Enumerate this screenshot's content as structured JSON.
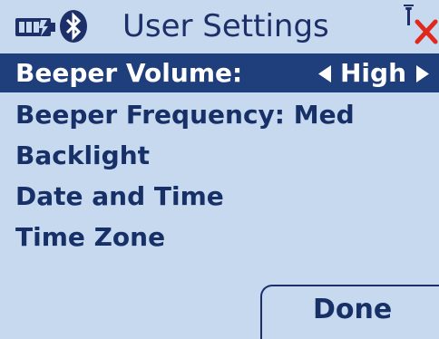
{
  "status": {
    "battery_icon": "battery-icon",
    "bluetooth_icon": "bluetooth-icon",
    "signal_icon": "no-signal-icon",
    "title": "User Settings"
  },
  "menu": {
    "selected": {
      "label": "Beeper Volume:",
      "value": "High"
    },
    "items": [
      {
        "label": "Beeper Frequency: Med"
      },
      {
        "label": "Backlight"
      },
      {
        "label": "Date and Time"
      },
      {
        "label": "Time Zone"
      }
    ]
  },
  "done_label": "Done",
  "colors": {
    "background": "#c6d9ee",
    "selection": "#1e3e7c",
    "text": "#173068",
    "error_x": "#e0281c"
  }
}
